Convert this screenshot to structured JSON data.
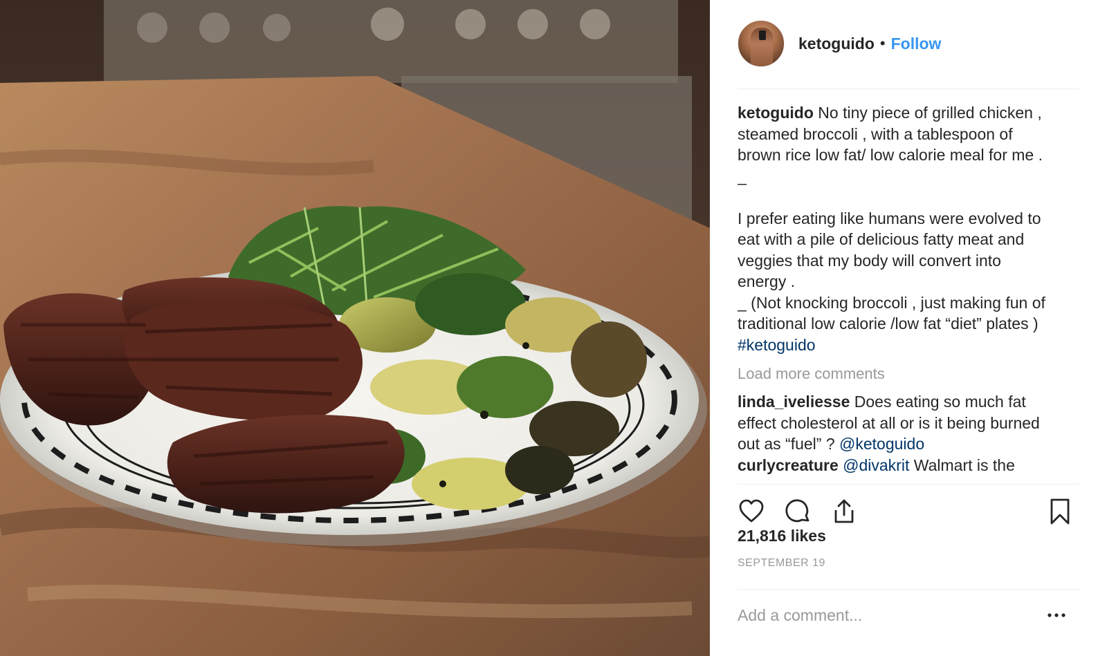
{
  "post": {
    "image_alt": "Plate of grilled steak, zucchini and arugula",
    "author": "ketoguido",
    "separator": "•",
    "follow_label": "Follow",
    "caption": {
      "username": "ketoguido",
      "line1": "No tiny piece of grilled chicken ,",
      "line2": "steamed broccoli , with a tablespoon of",
      "line3": "brown rice low fat/ low calorie meal for me .",
      "line4": "_",
      "line5": "I prefer eating like humans were evolved to",
      "line6": "eat with a pile of delicious fatty meat and",
      "line7": "veggies that my body will convert into",
      "line8": "energy .",
      "line9": "_ (Not knocking broccoli , just making fun of",
      "line10": "traditional low calorie /low fat “diet” plates )",
      "hashtag": "#ketoguido"
    },
    "load_more_label": "Load more comments",
    "comments": [
      {
        "username": "linda_iveliesse",
        "line1": "Does eating so much fat",
        "line2": "effect cholesterol at all or is it being burned",
        "line3": "out as “fuel” ?",
        "mention": "@ketoguido"
      },
      {
        "username": "curlycreature",
        "mention": "@divakrit",
        "text": "Walmart is the"
      }
    ],
    "likes": "21,816 likes",
    "date": "SEPTEMBER 19",
    "add_comment_placeholder": "Add a comment...",
    "more_label": "•••"
  },
  "icons": {
    "like": "heart-icon",
    "comment": "comment-bubble-icon",
    "share": "share-icon",
    "save": "bookmark-icon",
    "more": "more-dots-icon"
  },
  "colors": {
    "link_blue": "#3897f0",
    "hashtag_blue": "#003569",
    "muted_gray": "#999999",
    "text": "#262626"
  }
}
